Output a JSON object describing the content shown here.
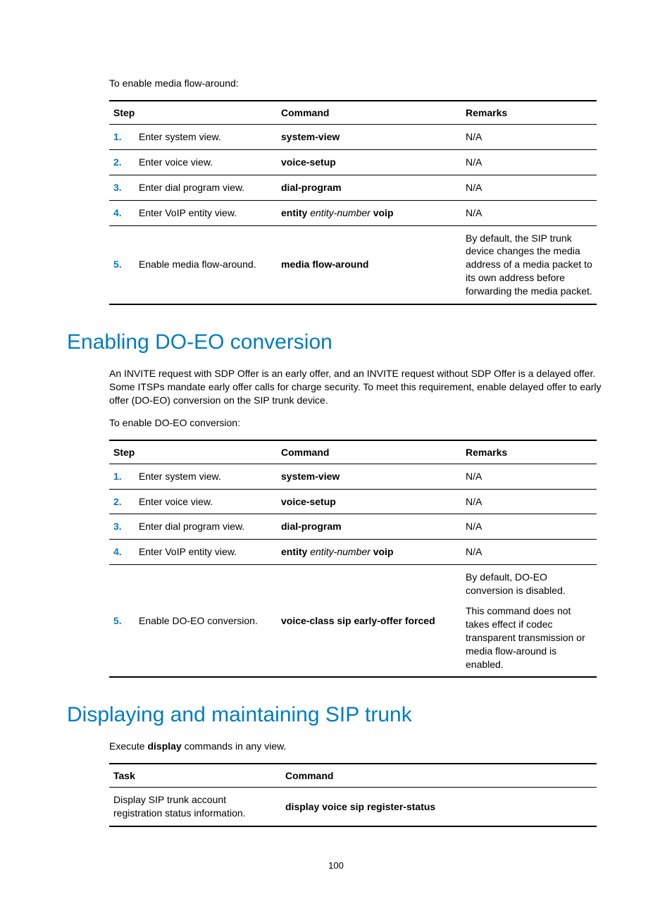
{
  "intro1": "To enable media flow-around:",
  "table1": {
    "headers": {
      "step": "Step",
      "command": "Command",
      "remarks": "Remarks"
    },
    "rows": [
      {
        "num": "1.",
        "step": "Enter system view.",
        "cmd_bold1": "system-view",
        "cmd_italic": "",
        "cmd_bold2": "",
        "remarks": "N/A"
      },
      {
        "num": "2.",
        "step": "Enter voice view.",
        "cmd_bold1": "voice-setup",
        "cmd_italic": "",
        "cmd_bold2": "",
        "remarks": "N/A"
      },
      {
        "num": "3.",
        "step": "Enter dial program view.",
        "cmd_bold1": "dial-program",
        "cmd_italic": "",
        "cmd_bold2": "",
        "remarks": "N/A"
      },
      {
        "num": "4.",
        "step": "Enter VoIP entity view.",
        "cmd_bold1": "entity",
        "cmd_italic": " entity-number ",
        "cmd_bold2": "voip",
        "remarks": "N/A"
      },
      {
        "num": "5.",
        "step": "Enable media flow-around.",
        "cmd_bold1": "media flow-around",
        "cmd_italic": "",
        "cmd_bold2": "",
        "remarks": "By default, the SIP trunk device changes the media address of a media packet to its own address before forwarding the media packet."
      }
    ]
  },
  "heading1": "Enabling DO-EO conversion",
  "para1": "An INVITE request with SDP Offer is an early offer, and an INVITE request without SDP Offer is a delayed offer. Some ITSPs mandate early offer calls for charge security. To meet this requirement, enable delayed offer to early offer (DO-EO) conversion on the SIP trunk device.",
  "intro2": "To enable DO-EO conversion:",
  "table2": {
    "headers": {
      "step": "Step",
      "command": "Command",
      "remarks": "Remarks"
    },
    "rows": [
      {
        "num": "1.",
        "step": "Enter system view.",
        "cmd_bold1": "system-view",
        "cmd_italic": "",
        "cmd_bold2": "",
        "remarks": "N/A",
        "remarks2": ""
      },
      {
        "num": "2.",
        "step": "Enter voice view.",
        "cmd_bold1": "voice-setup",
        "cmd_italic": "",
        "cmd_bold2": "",
        "remarks": "N/A",
        "remarks2": ""
      },
      {
        "num": "3.",
        "step": "Enter dial program view.",
        "cmd_bold1": "dial-program",
        "cmd_italic": "",
        "cmd_bold2": "",
        "remarks": "N/A",
        "remarks2": ""
      },
      {
        "num": "4.",
        "step": "Enter VoIP entity view.",
        "cmd_bold1": "entity",
        "cmd_italic": " entity-number ",
        "cmd_bold2": "voip",
        "remarks": "N/A",
        "remarks2": ""
      },
      {
        "num": "5.",
        "step": "Enable DO-EO conversion.",
        "cmd_bold1": "voice-class sip early-offer forced",
        "cmd_italic": "",
        "cmd_bold2": "",
        "remarks": "By default, DO-EO conversion is disabled.",
        "remarks2": "This command does not takes effect if codec transparent transmission or media flow-around is enabled."
      }
    ]
  },
  "heading2": "Displaying and maintaining SIP trunk",
  "para2_pre": "Execute ",
  "para2_bold": "display",
  "para2_post": " commands in any view.",
  "table3": {
    "headers": {
      "task": "Task",
      "command": "Command"
    },
    "rows": [
      {
        "task": "Display SIP trunk account registration status information.",
        "cmd": "display voice sip register-status"
      }
    ]
  },
  "page_number": "100"
}
